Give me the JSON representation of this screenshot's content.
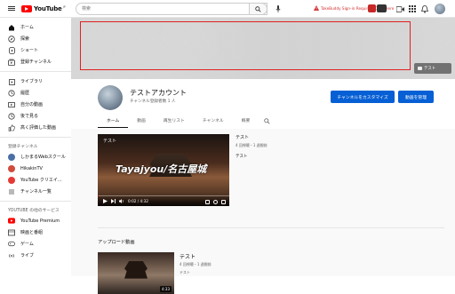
{
  "header": {
    "logo_text": "YouTube",
    "logo_region": "JP",
    "search_placeholder": "検索",
    "extension_alert": "TakeBuddy Sign-in Required. Click Here"
  },
  "sidebar": {
    "main": [
      {
        "label": "ホーム",
        "icon": "home-icon"
      },
      {
        "label": "探索",
        "icon": "explore-icon"
      },
      {
        "label": "ショート",
        "icon": "shorts-icon"
      },
      {
        "label": "登録チャンネル",
        "icon": "subscriptions-icon"
      }
    ],
    "library": [
      {
        "label": "ライブラリ",
        "icon": "library-icon"
      },
      {
        "label": "履歴",
        "icon": "history-icon"
      },
      {
        "label": "自分の動画",
        "icon": "your-videos-icon"
      },
      {
        "label": "後で見る",
        "icon": "watch-later-icon"
      },
      {
        "label": "高く評価した動画",
        "icon": "liked-icon"
      }
    ],
    "subs_heading": "登録チャンネル",
    "subscriptions": [
      {
        "label": "しかまるWebスクール",
        "color": "#4a6fa5"
      },
      {
        "label": "HikakinTV",
        "color": "#d14b3c"
      },
      {
        "label": "YouTube クリエイ...",
        "color": "#e53935"
      },
      {
        "label": "チャンネル一覧",
        "color": "#606060"
      }
    ],
    "services_heading": "YOUTUBE の他のサービス",
    "services": [
      {
        "label": "YouTube Premium",
        "icon": "premium-icon"
      },
      {
        "label": "映画と番組",
        "icon": "movies-icon"
      },
      {
        "label": "ゲーム",
        "icon": "gaming-icon"
      },
      {
        "label": "ライブ",
        "icon": "live-icon"
      }
    ]
  },
  "banner": {
    "customize_label": "テスト"
  },
  "channel": {
    "name": "テストアカウント",
    "subscribers": "チャンネル登録者数 1 人",
    "customize_button": "チャンネルをカスタマイズ",
    "manage_button": "動画を管理",
    "tabs": [
      "ホーム",
      "動画",
      "再生リスト",
      "チャンネル",
      "概要"
    ]
  },
  "featured": {
    "title": "テスト",
    "overlay_text": "Tayajyou/名古屋城",
    "time": "0:02 / 4:32",
    "progress": 0.01,
    "meta_title": "テスト",
    "meta_views": "4 回視聴・1 週間前",
    "meta_desc": "テスト"
  },
  "uploads": {
    "heading": "アップロード動画",
    "items": [
      {
        "title": "テスト",
        "views": "4 回視聴・1 週間前",
        "channel": "テスト",
        "duration": "4:33"
      }
    ]
  }
}
